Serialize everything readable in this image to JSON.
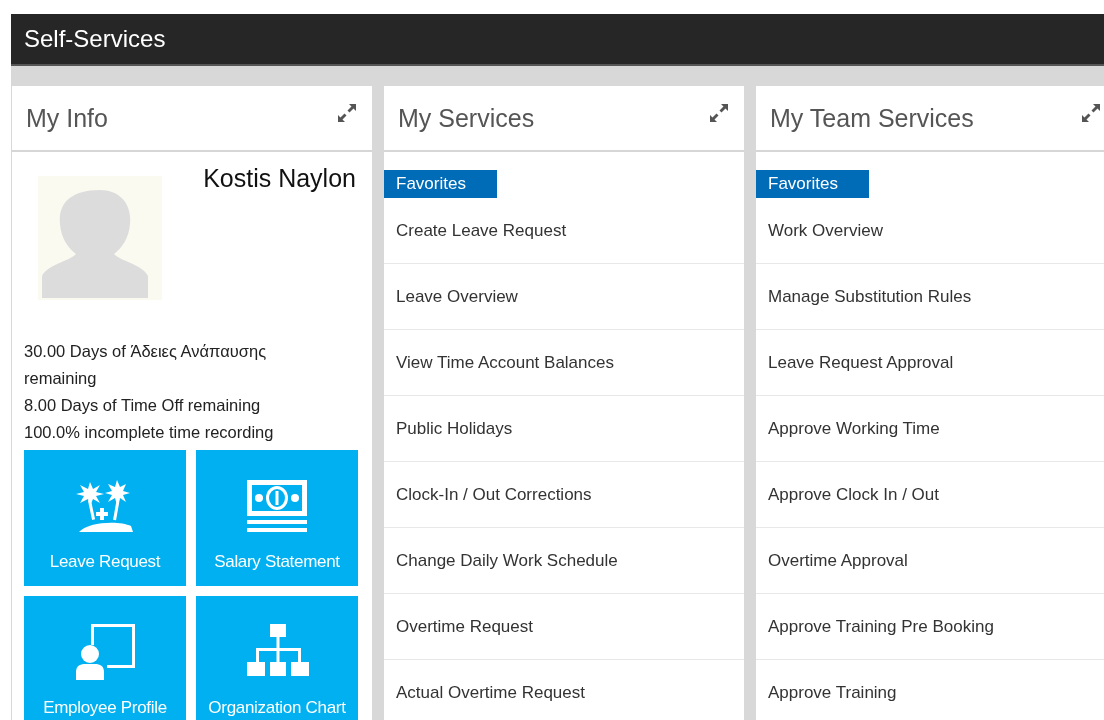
{
  "header": {
    "title": "Self-Services"
  },
  "my_info": {
    "title": "My Info",
    "name": "Kostis Naylon",
    "stats": [
      "30.00 Days of Άδειες Ανάπαυσης remaining",
      "8.00 Days of Time Off remaining",
      "100.0% incomplete time recording"
    ],
    "tiles": [
      {
        "kind": "vacation",
        "label": "Leave Request"
      },
      {
        "kind": "money",
        "label": "Salary Statement"
      },
      {
        "kind": "profile",
        "label": "Employee Profile"
      },
      {
        "kind": "org",
        "label": "Organization Chart"
      }
    ]
  },
  "my_services": {
    "title": "My Services",
    "section": "Favorites",
    "items": [
      "Create Leave Request",
      "Leave Overview",
      "View Time Account Balances",
      "Public Holidays",
      "Clock-In / Out Corrections",
      "Change Daily Work Schedule",
      "Overtime Request",
      "Actual Overtime Request"
    ]
  },
  "my_team_services": {
    "title": "My Team Services",
    "section": "Favorites",
    "items": [
      "Work Overview",
      "Manage Substitution Rules",
      "Leave Request Approval",
      "Approve Working Time",
      "Approve Clock In / Out",
      "Overtime Approval",
      "Approve Training Pre Booking",
      "Approve Training"
    ]
  }
}
